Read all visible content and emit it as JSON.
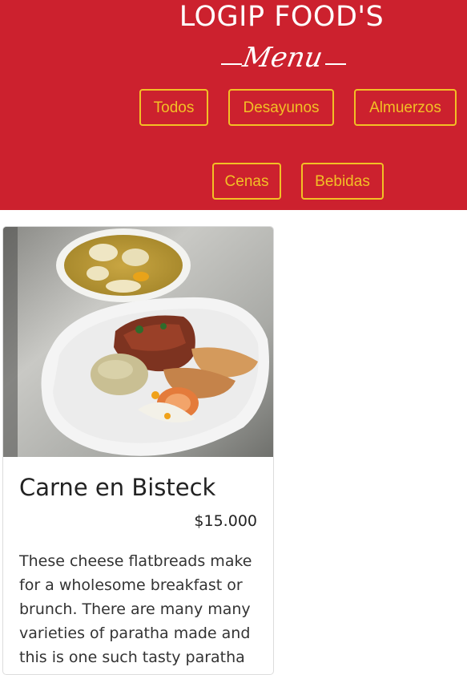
{
  "header": {
    "brand": "LOGIP FOOD'S",
    "script_label": "Menu"
  },
  "categories": [
    "Todos",
    "Desayunos",
    "Almuerzos",
    "Cenas",
    "Bebidas"
  ],
  "colors": {
    "header_bg": "#cc212e",
    "accent": "#f2c025",
    "text": "#222222"
  },
  "card": {
    "title": "Carne en Bisteck",
    "price": "$15.000",
    "description": "These cheese flatbreads make for a wholesome breakfast or brunch. There are many many varieties of paratha made and this is one such tasty paratha"
  }
}
